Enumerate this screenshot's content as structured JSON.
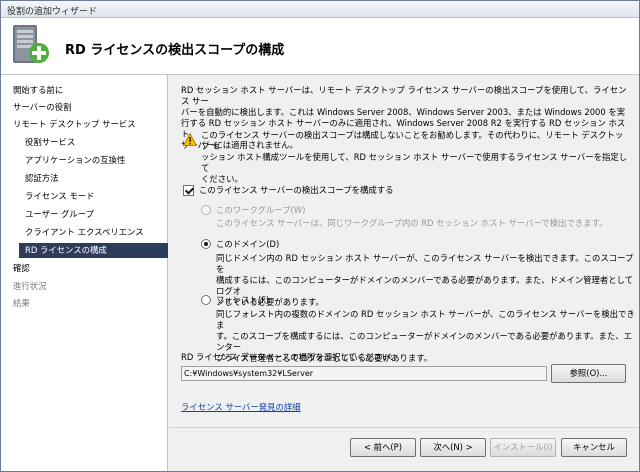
{
  "window": {
    "title": "役割の追加ウィザード"
  },
  "header": {
    "title": "RD ライセンスの検出スコープの構成",
    "icon": "server-add-icon"
  },
  "sidebar": {
    "items": [
      {
        "label": "開始する前に",
        "state": "normal"
      },
      {
        "label": "サーバーの役割",
        "state": "normal"
      },
      {
        "label": "リモート デスクトップ サービス",
        "state": "normal"
      },
      {
        "label": "役割サービス",
        "state": "normal"
      },
      {
        "label": "アプリケーションの互換性",
        "state": "normal"
      },
      {
        "label": "認証方法",
        "state": "normal"
      },
      {
        "label": "ライセンス モード",
        "state": "normal"
      },
      {
        "label": "ユーザー グループ",
        "state": "normal"
      },
      {
        "label": "クライアント エクスペリエンス",
        "state": "normal"
      },
      {
        "label": "RD ライセンスの構成",
        "state": "selected"
      },
      {
        "label": "確認",
        "state": "normal"
      },
      {
        "label": "進行状況",
        "state": "disabled"
      },
      {
        "label": "結果",
        "state": "disabled"
      }
    ]
  },
  "main": {
    "description_lines": [
      "RD セッション ホスト サーバーは、リモート デスクトップ ライセンス サーバーの検出スコープを使用して、ライセンス サー",
      "バーを自動的に検出します。これは Windows Server 2008、Windows Server 2003、または Windows 2000 を実",
      "行する RD セッション ホスト サーバーのみに適用され、Windows Server 2008 R2 を実行する RD セッション ホスト",
      "サーバーには適用されません。"
    ],
    "warning_lines": [
      "このライセンス サーバーの検出スコープは構成しないことをお勧めします。その代わりに、リモート デスクトップ セ",
      "ッション ホスト構成ツールを使用して、RD セッション ホスト サーバーで使用するライセンス サーバーを指定して",
      "ください。"
    ],
    "configure_checkbox": {
      "label": "このライセンス サーバーの検出スコープを構成する",
      "checked": true
    },
    "options": [
      {
        "label": "このワークグループ(W)",
        "selected": false,
        "enabled": false,
        "desc_lines": [
          "このライセンス サーバーは、同じワークグループ内の RD セッション ホスト サーバーで検出できます。"
        ]
      },
      {
        "label": "このドメイン(D)",
        "selected": true,
        "enabled": true,
        "desc_lines": [
          "同じドメイン内の RD セッション ホスト サーバーが、このライセンス サーバーを検出できます。このスコープを",
          "構成するには、このコンピューターがドメインのメンバーである必要があります。また、ドメイン管理者としてログオ",
          "ンしている必要があります。"
        ]
      },
      {
        "label": "フォレスト(F)",
        "selected": false,
        "enabled": true,
        "desc_lines": [
          "同じフォレスト内の複数のドメインの RD セッション ホスト サーバーが、このライセンス サーバーを検出できま",
          "す。このスコープを構成するには、このコンピューターがドメインのメンバーである必要があります。また、エンター",
          "プライズ管理者としてログオンしている必要があります。"
        ]
      }
    ],
    "db_label": "RD ライセンス データベースの場所を選択してください:",
    "db_path": "C:¥Windows¥system32¥LServer",
    "browse_label": "参照(O)...",
    "link_label": "ライセンス サーバー発見の詳細"
  },
  "footer": {
    "prev_label": "< 前へ(P)",
    "next_label": "次へ(N) >",
    "install_label": "インストール(I)",
    "cancel_label": "キャンセル"
  },
  "colors": {
    "selection": "#2d3c5a",
    "link": "#0645ad",
    "warning": "#f2c200"
  }
}
